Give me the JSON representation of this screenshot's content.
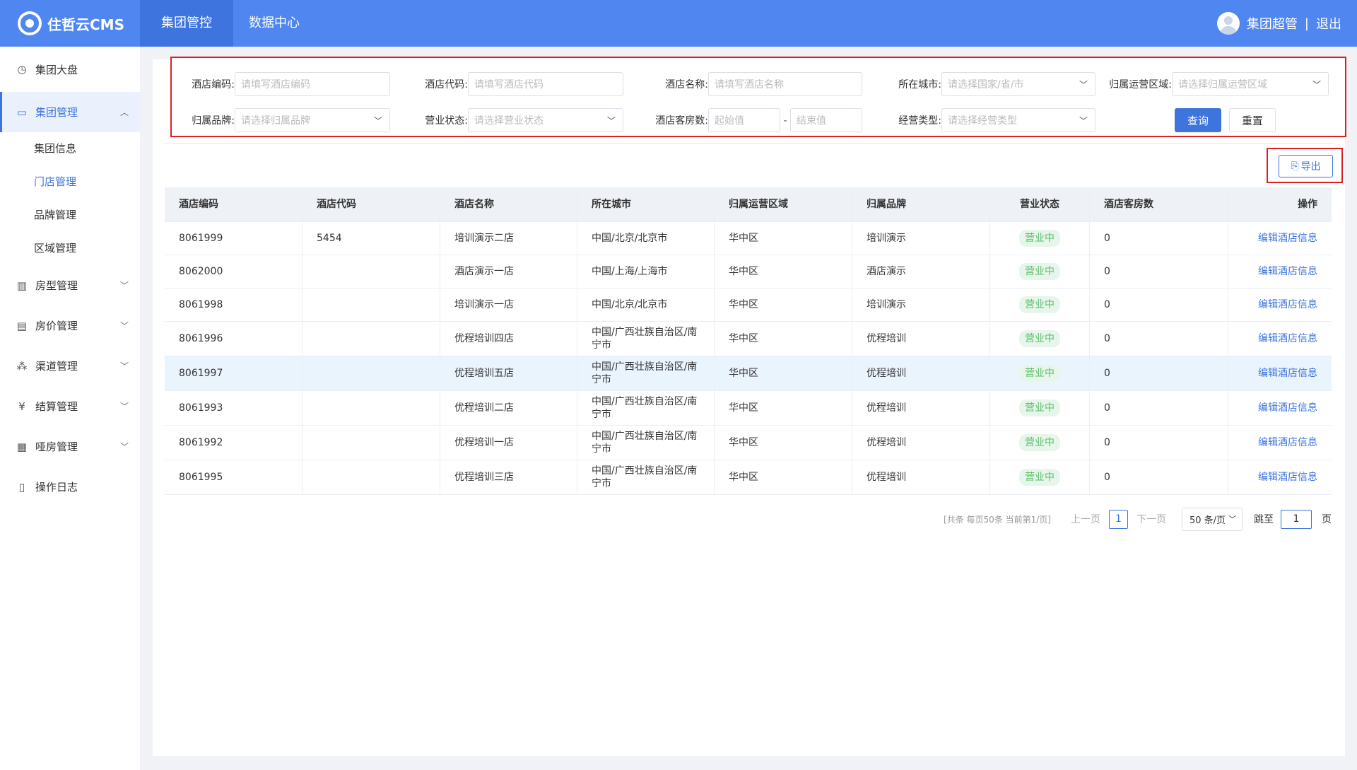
{
  "header": {
    "logo_text": "住哲云CMS",
    "nav": [
      "集团管控",
      "数据中心"
    ],
    "user_name": "集团超管",
    "separator": "|",
    "logout": "退出"
  },
  "sidebar": {
    "items": [
      {
        "label": "集团大盘",
        "icon": "clock-icon"
      },
      {
        "label": "集团管理",
        "icon": "monitor-icon",
        "expanded": true
      },
      {
        "label": "房型管理",
        "icon": "building-icon"
      },
      {
        "label": "房价管理",
        "icon": "card-icon"
      },
      {
        "label": "渠道管理",
        "icon": "share-icon"
      },
      {
        "label": "结算管理",
        "icon": "yen-icon"
      },
      {
        "label": "哑房管理",
        "icon": "document-icon"
      },
      {
        "label": "操作日志",
        "icon": "file-icon"
      }
    ],
    "sub_items": [
      "集团信息",
      "门店管理",
      "品牌管理",
      "区域管理"
    ],
    "active_sub": "门店管理"
  },
  "filters": {
    "hotel_code": {
      "label": "酒店编码:",
      "placeholder": "请填写酒店编码"
    },
    "hotel_id": {
      "label": "酒店代码:",
      "placeholder": "请填写酒店代码"
    },
    "hotel_name": {
      "label": "酒店名称:",
      "placeholder": "请填写酒店名称"
    },
    "city": {
      "label": "所在城市:",
      "placeholder": "请选择国家/省/市"
    },
    "region": {
      "label": "归属运营区域:",
      "placeholder": "请选择归属运营区域"
    },
    "brand": {
      "label": "归属品牌:",
      "placeholder": "请选择归属品牌"
    },
    "status": {
      "label": "营业状态:",
      "placeholder": "请选择营业状态"
    },
    "rooms": {
      "label": "酒店客房数:",
      "min_placeholder": "起始值",
      "max_placeholder": "结束值",
      "dash": "-"
    },
    "biz_type": {
      "label": "经营类型:",
      "placeholder": "请选择经营类型"
    },
    "query_btn": "查询",
    "reset_btn": "重置"
  },
  "toolbar": {
    "export_label": "导出"
  },
  "table": {
    "columns": [
      "酒店编码",
      "酒店代码",
      "酒店名称",
      "所在城市",
      "归属运营区域",
      "归属品牌",
      "营业状态",
      "酒店客房数",
      "操作"
    ],
    "rows": [
      {
        "code": "8061999",
        "id": "5454",
        "name": "培训演示二店",
        "city": "中国/北京/北京市",
        "region": "华中区",
        "brand": "培训演示",
        "status": "营业中",
        "rooms": "0",
        "action": "编辑酒店信息"
      },
      {
        "code": "8062000",
        "id": "",
        "name": "酒店演示一店",
        "city": "中国/上海/上海市",
        "region": "华中区",
        "brand": "酒店演示",
        "status": "营业中",
        "rooms": "0",
        "action": "编辑酒店信息"
      },
      {
        "code": "8061998",
        "id": "",
        "name": "培训演示一店",
        "city": "中国/北京/北京市",
        "region": "华中区",
        "brand": "培训演示",
        "status": "营业中",
        "rooms": "0",
        "action": "编辑酒店信息"
      },
      {
        "code": "8061996",
        "id": "",
        "name": "优程培训四店",
        "city": "中国/广西壮族自治区/南宁市",
        "region": "华中区",
        "brand": "优程培训",
        "status": "营业中",
        "rooms": "0",
        "action": "编辑酒店信息"
      },
      {
        "code": "8061997",
        "id": "",
        "name": "优程培训五店",
        "city": "中国/广西壮族自治区/南宁市",
        "region": "华中区",
        "brand": "优程培训",
        "status": "营业中",
        "rooms": "0",
        "action": "编辑酒店信息"
      },
      {
        "code": "8061993",
        "id": "",
        "name": "优程培训二店",
        "city": "中国/广西壮族自治区/南宁市",
        "region": "华中区",
        "brand": "优程培训",
        "status": "营业中",
        "rooms": "0",
        "action": "编辑酒店信息"
      },
      {
        "code": "8061992",
        "id": "",
        "name": "优程培训一店",
        "city": "中国/广西壮族自治区/南宁市",
        "region": "华中区",
        "brand": "优程培训",
        "status": "营业中",
        "rooms": "0",
        "action": "编辑酒店信息"
      },
      {
        "code": "8061995",
        "id": "",
        "name": "优程培训三店",
        "city": "中国/广西壮族自治区/南宁市",
        "region": "华中区",
        "brand": "优程培训",
        "status": "营业中",
        "rooms": "0",
        "action": "编辑酒店信息"
      }
    ]
  },
  "pagination": {
    "info": "[共条 每页50条 当前第1/页]",
    "prev": "上一页",
    "current": "1",
    "next": "下一页",
    "page_size": "50 条/页",
    "jump_label": "跳至",
    "jump_value": "1",
    "page_unit": "页"
  },
  "colors": {
    "primary": "#4f86f0",
    "accent": "#3d74dd",
    "success": "#5bbf6a",
    "highlight": "#e02020"
  }
}
